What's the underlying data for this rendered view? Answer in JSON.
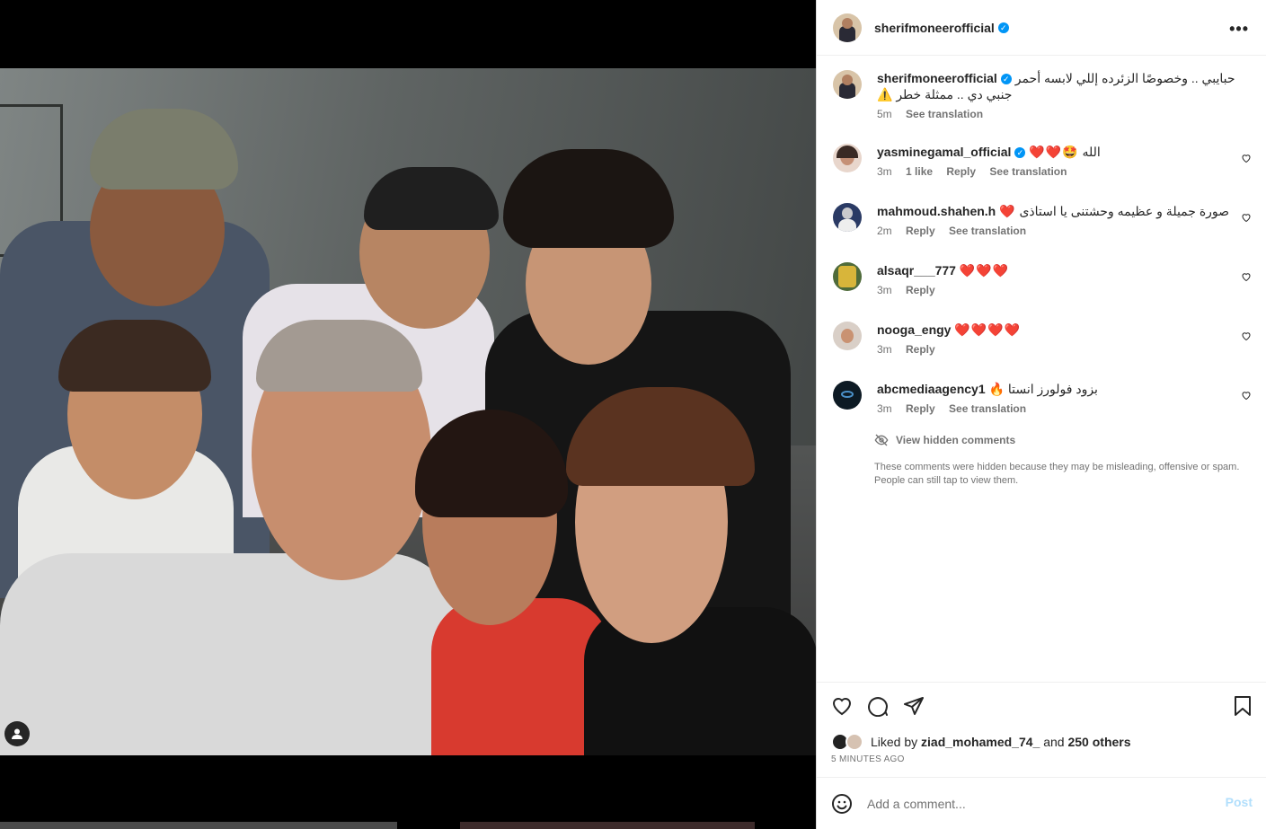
{
  "post": {
    "username": "sherifmoneerofficial",
    "verified_glyph": "✓",
    "more_label": "•••"
  },
  "caption": {
    "username": "sherifmoneerofficial",
    "text": "حبايبي .. وخصوصًا الزئرده إللي لابسه أحمر",
    "text2": "جنبي دي .. ممثلة خطر ⚠️",
    "age": "5m",
    "see_translation": "See translation"
  },
  "comments": [
    {
      "username": "yasminegamal_official",
      "verified": true,
      "text": "الله",
      "emoji": "❤️❤️🤩",
      "age": "3m",
      "likes": "1 like",
      "reply": "Reply",
      "see_translation": "See translation"
    },
    {
      "username": "mahmoud.shahen.h",
      "verified": false,
      "text": "صورة جميلة و عظيمه وحشتنى يا استاذى",
      "emoji": "❤️",
      "age": "2m",
      "reply": "Reply",
      "see_translation": "See translation"
    },
    {
      "username": "alsaqr___777",
      "verified": false,
      "text": "",
      "emoji": "❤️❤️❤️",
      "age": "3m",
      "reply": "Reply"
    },
    {
      "username": "nooga_engy",
      "verified": false,
      "text": "",
      "emoji": "❤️❤️❤️❤️",
      "age": "3m",
      "reply": "Reply"
    },
    {
      "username": "abcmediaagency1",
      "verified": false,
      "text": "بزود فولورز انستا",
      "emoji": "🔥",
      "age": "3m",
      "reply": "Reply",
      "see_translation": "See translation"
    }
  ],
  "hidden": {
    "link": "View hidden comments",
    "note": "These comments were hidden because they may be misleading, offensive or spam. People can still tap to view them."
  },
  "likes": {
    "prefix": "Liked by",
    "user": "ziad_mohamed_74_",
    "and": "and",
    "others": "250 others"
  },
  "time": "5 MINUTES AGO",
  "add_comment": {
    "placeholder": "Add a comment...",
    "post_label": "Post"
  },
  "colors": {
    "verified": "#0095f6",
    "heart": "#e0245e",
    "post_disabled": "#b2dffc"
  }
}
